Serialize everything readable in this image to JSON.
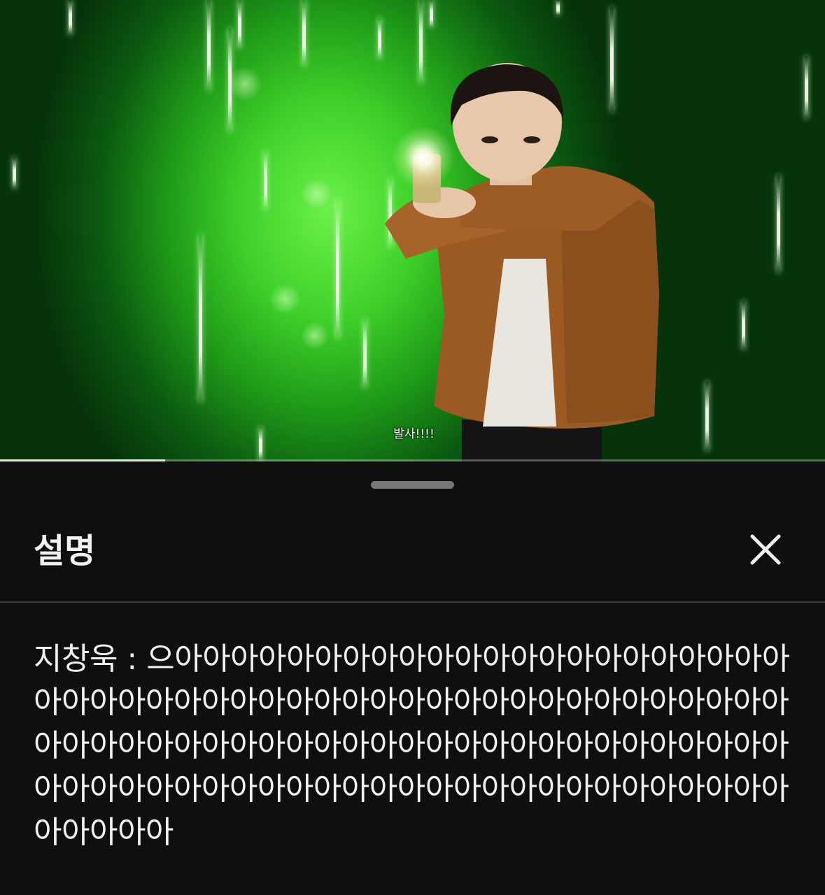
{
  "video": {
    "subtitle": "발사!!!!",
    "progress_fraction": 0.2
  },
  "sheet": {
    "title": "설명",
    "close_icon": "close-icon",
    "description": "지창욱 : 으아아아아아아아아아아아아아아아아아아아아아아아아아아아아아아아아아아아아아아아아아아아아아아아아아아아아아아아아아아아아아아아아아아아아아아아아아아아아아아아아아아아아아아아아아아아아아아아아아아아아아아아아아아아아"
  },
  "colors": {
    "background": "#0f0f0f",
    "text": "#f1f1f1",
    "video_green": "#3fd12a"
  }
}
